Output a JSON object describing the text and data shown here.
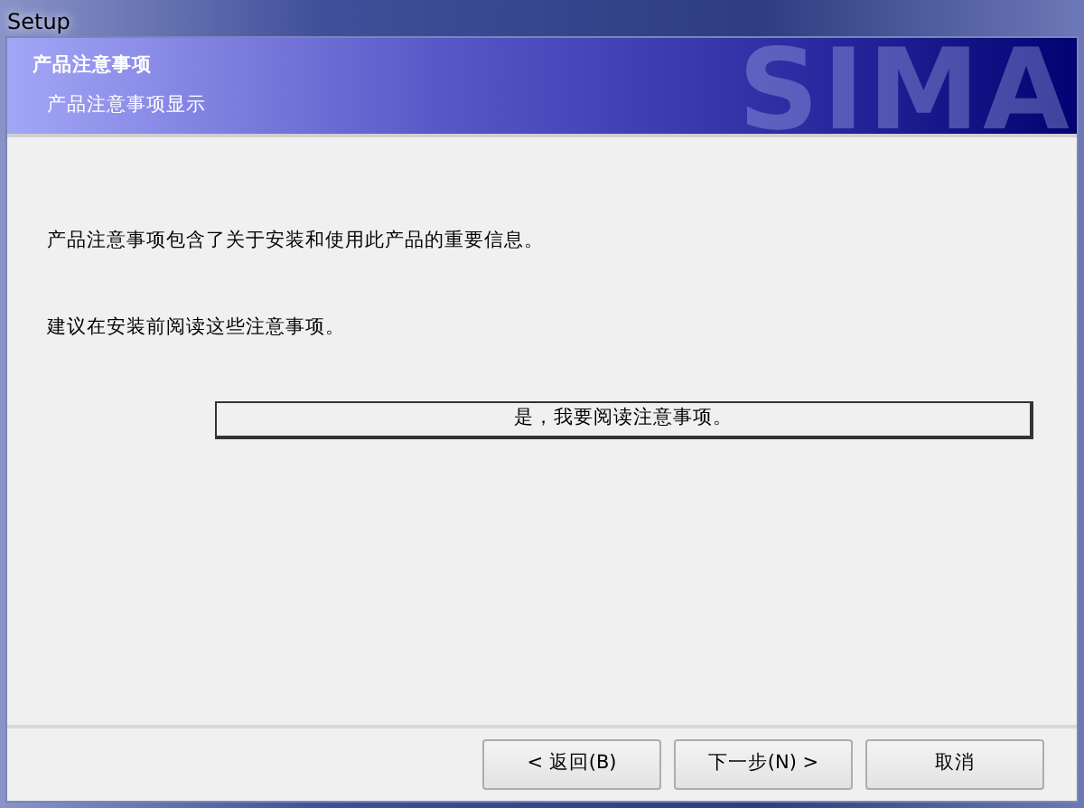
{
  "window": {
    "title": "Setup"
  },
  "banner": {
    "title": "产品注意事项",
    "subtitle": "产品注意事项显示",
    "logo_text": "SIMA"
  },
  "body": {
    "paragraphs": [
      "产品注意事项包含了关于安装和使用此产品的重要信息。",
      "建议在安装前阅读这些注意事项。"
    ],
    "action_button": "是，我要阅读注意事项。"
  },
  "buttons": [
    {
      "label": "< 返回(B)"
    },
    {
      "label": "下一步(N) >"
    },
    {
      "label": "取消"
    }
  ]
}
